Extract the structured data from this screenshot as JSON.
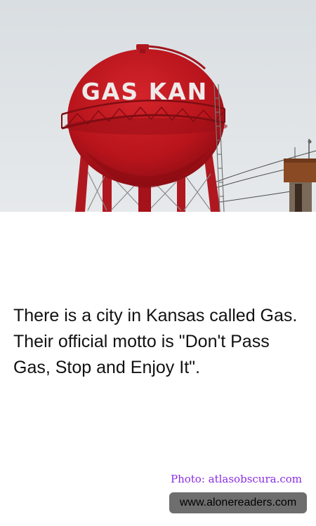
{
  "photo": {
    "tower_text": "GAS KAN"
  },
  "fact": {
    "text": "There is a city in Kansas called Gas. Their official motto is \"Don't Pass Gas, Stop and Enjoy It\"."
  },
  "credit": {
    "text": "Photo: atlasobscura.com"
  },
  "site": {
    "text": "www.alonereaders.com"
  }
}
